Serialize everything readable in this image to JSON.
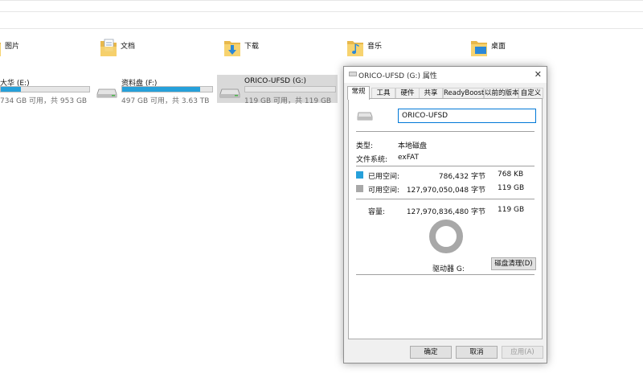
{
  "folders": [
    {
      "label": "图片",
      "icon": "pictures-folder-icon"
    },
    {
      "label": "文档",
      "icon": "documents-folder-icon"
    },
    {
      "label": "下载",
      "icon": "downloads-folder-icon"
    },
    {
      "label": "音乐",
      "icon": "music-folder-icon"
    },
    {
      "label": "桌面",
      "icon": "desktop-folder-icon"
    }
  ],
  "drives": [
    {
      "name": "大华 (E:)",
      "info": "734 GB 可用，共 953 GB",
      "used_fraction": 0.23
    },
    {
      "name": "资料盘 (F:)",
      "info": "497 GB 可用，共 3.63 TB",
      "used_fraction": 0.87
    },
    {
      "name": "ORICO-UFSD (G:)",
      "info": "119 GB 可用，共 119 GB",
      "used_fraction": 0.0
    }
  ],
  "dialog": {
    "title": "ORICO-UFSD (G:) 属性",
    "tabs": [
      "常规",
      "工具",
      "硬件",
      "共享",
      "ReadyBoost",
      "以前的版本",
      "自定义"
    ],
    "name_value": "ORICO-UFSD",
    "type_label": "类型:",
    "type_value": "本地磁盘",
    "fs_label": "文件系统:",
    "fs_value": "exFAT",
    "used_label": "已用空间:",
    "used_bytes": "786,432 字节",
    "used_size": "768 KB",
    "free_label": "可用空间:",
    "free_bytes": "127,970,050,048 字节",
    "free_size": "119 GB",
    "capacity_label": "容量:",
    "capacity_bytes": "127,970,836,480 字节",
    "capacity_size": "119 GB",
    "drive_label": "驱动器 G:",
    "cleanup_button": "磁盘清理(D)",
    "ok_button": "确定",
    "cancel_button": "取消",
    "apply_button": "应用(A)",
    "used_fraction": 6e-06
  },
  "colors": {
    "used": "#26a0da",
    "free": "#a8a8a8",
    "accent": "#0078d7"
  }
}
